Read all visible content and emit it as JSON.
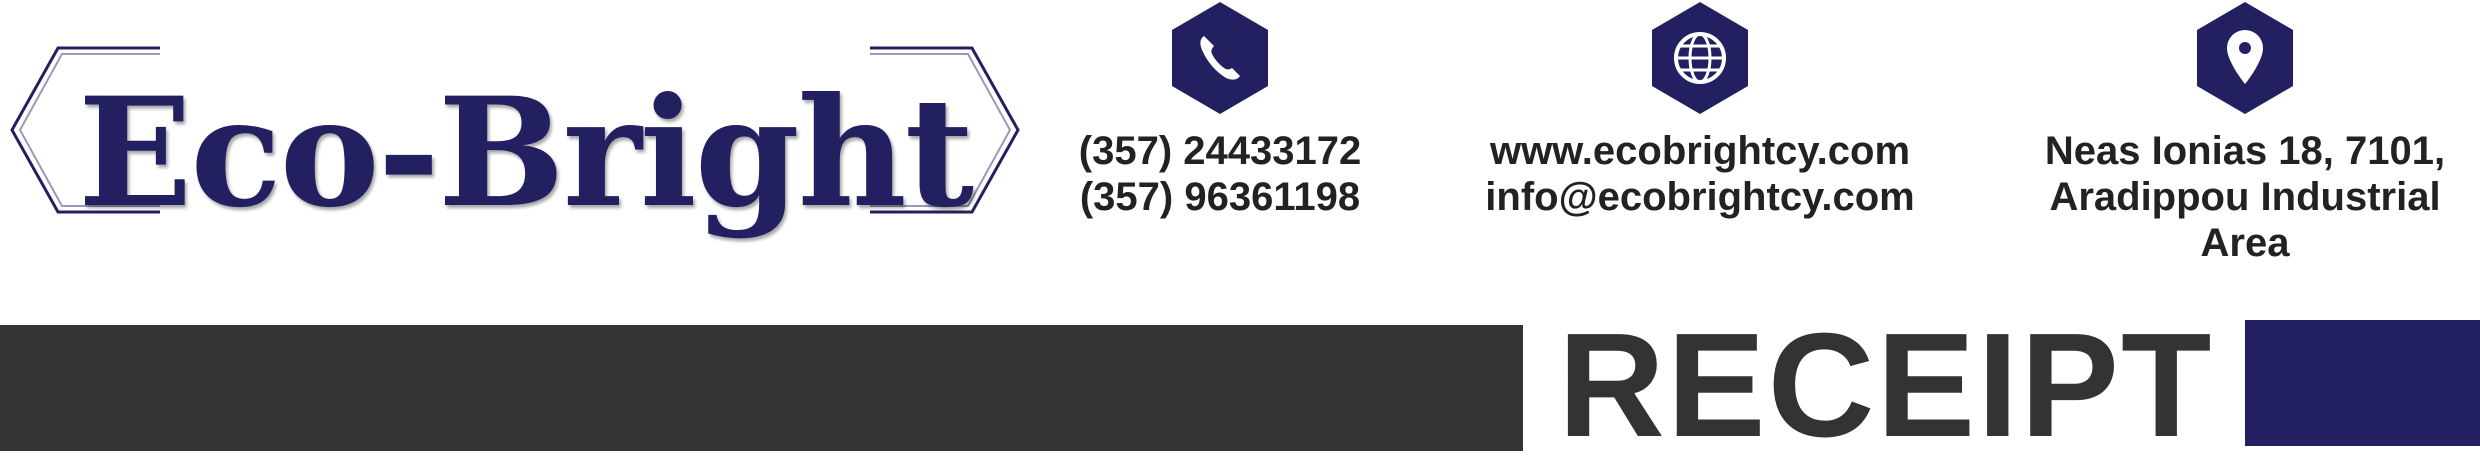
{
  "brand": {
    "name": "Eco-Bright",
    "color": "#232062"
  },
  "contacts": {
    "phone": {
      "icon": "phone-icon",
      "lines": [
        "(357) 24433172",
        "(357) 96361198"
      ]
    },
    "web": {
      "icon": "globe-icon",
      "lines": [
        "www.ecobrightcy.com",
        "info@ecobrightcy.com"
      ]
    },
    "address": {
      "icon": "location-pin-icon",
      "lines": [
        "Neas Ionias 18, 7101,",
        "Aradippou Industrial",
        "Area"
      ]
    }
  },
  "document": {
    "title": "RECEIPT"
  },
  "colors": {
    "dark_band": "#333333",
    "accent_band": "#232062",
    "icon_hex": "#232062"
  }
}
